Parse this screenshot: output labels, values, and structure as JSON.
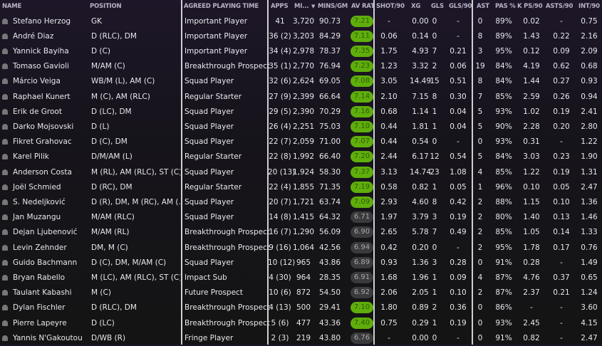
{
  "headers": {
    "name": "NAME",
    "position": "POSITION",
    "playing_time": "AGREED PLAYING TIME",
    "apps": "APPS",
    "mins": "MI...",
    "sort_icon": "▼",
    "mins_gm": "MINS/GM",
    "av_rat": "AV RAT",
    "shot90": "SHOT/90",
    "xg": "XG",
    "gls": "GLS",
    "gls90": "GLS/90",
    "ast": "AST",
    "pas": "PAS %",
    "kps90": "K PS/90",
    "asts90": "ASTS/90",
    "int90": "INT/90"
  },
  "colors": {
    "rating_good": "#5fae0b",
    "rating_neutral": "#3a3a3c"
  },
  "players": [
    [
      "Stefano Herzog",
      "GK",
      "Important Player",
      "41",
      "3,720",
      "90.73",
      "7.21",
      "-",
      "0.00",
      "0",
      "-",
      "0",
      "89%",
      "0.02",
      "-",
      "0.75"
    ],
    [
      "André Diaz",
      "D (RLC), DM",
      "Important Player",
      "36 (2)",
      "3,203",
      "84.29",
      "7.11",
      "0.06",
      "0.14",
      "0",
      "-",
      "8",
      "89%",
      "1.43",
      "0.22",
      "2.16"
    ],
    [
      "Yannick Bayiha",
      "D (C)",
      "Important Player",
      "34 (4)",
      "2,978",
      "78.37",
      "7.35",
      "1.75",
      "4.93",
      "7",
      "0.21",
      "3",
      "95%",
      "0.12",
      "0.09",
      "2.09"
    ],
    [
      "Tomaso Gavioli",
      "M/AM (C)",
      "Breakthrough Prospect",
      "35 (1)",
      "2,770",
      "76.94",
      "7.23",
      "1.23",
      "3.32",
      "2",
      "0.06",
      "19",
      "84%",
      "4.19",
      "0.62",
      "0.68"
    ],
    [
      "Márcio Veiga",
      "WB/M (L), AM (C)",
      "Squad Player",
      "32 (6)",
      "2,624",
      "69.05",
      "7.08",
      "3.05",
      "14.49",
      "15",
      "0.51",
      "8",
      "84%",
      "1.44",
      "0.27",
      "0.93"
    ],
    [
      "Raphael Kunert",
      "M (C), AM (RLC)",
      "Regular Starter",
      "27 (9)",
      "2,399",
      "66.64",
      "7.14",
      "2.10",
      "7.15",
      "8",
      "0.30",
      "7",
      "85%",
      "2.59",
      "0.26",
      "0.94"
    ],
    [
      "Erik de Groot",
      "D (LC), DM",
      "Squad Player",
      "29 (5)",
      "2,390",
      "70.29",
      "7.16",
      "0.68",
      "1.14",
      "1",
      "0.04",
      "5",
      "93%",
      "1.02",
      "0.19",
      "2.41"
    ],
    [
      "Darko Mojsovski",
      "D (L)",
      "Squad Player",
      "26 (4)",
      "2,251",
      "75.03",
      "7.10",
      "0.44",
      "1.81",
      "1",
      "0.04",
      "5",
      "90%",
      "2.28",
      "0.20",
      "2.80"
    ],
    [
      "Fikret Grahovac",
      "D (C), DM",
      "Squad Player",
      "22 (7)",
      "2,059",
      "71.00",
      "7.07",
      "0.44",
      "0.54",
      "0",
      "-",
      "0",
      "93%",
      "0.31",
      "-",
      "1.22"
    ],
    [
      "Karel Pilik",
      "D/M/AM (L)",
      "Regular Starter",
      "22 (8)",
      "1,992",
      "66.40",
      "7.20",
      "2.44",
      "6.17",
      "12",
      "0.54",
      "5",
      "84%",
      "3.03",
      "0.23",
      "1.90"
    ],
    [
      "Anderson Costa",
      "M (RL), AM (RLC), ST (C)",
      "Squad Player",
      "20 (13)",
      "1,924",
      "58.30",
      "7.37",
      "3.13",
      "14.74",
      "23",
      "1.08",
      "4",
      "85%",
      "1.22",
      "0.19",
      "1.31"
    ],
    [
      "Joël Schmied",
      "D (RC), DM",
      "Regular Starter",
      "22 (4)",
      "1,855",
      "71.35",
      "7.19",
      "0.58",
      "0.82",
      "1",
      "0.05",
      "1",
      "96%",
      "0.10",
      "0.05",
      "2.47"
    ],
    [
      "S. Nedeljković",
      "D (R), DM, M (RC), AM (...",
      "Squad Player",
      "20 (7)",
      "1,721",
      "63.74",
      "7.09",
      "2.93",
      "4.60",
      "8",
      "0.42",
      "2",
      "88%",
      "1.15",
      "0.10",
      "1.36"
    ],
    [
      "Jan Muzangu",
      "M/AM (RLC)",
      "Squad Player",
      "14 (8)",
      "1,415",
      "64.32",
      "6.71",
      "1.97",
      "3.79",
      "3",
      "0.19",
      "2",
      "80%",
      "1.40",
      "0.13",
      "1.46"
    ],
    [
      "Dejan Ljubenović",
      "M/AM (RL)",
      "Breakthrough Prospect",
      "16 (7)",
      "1,290",
      "56.09",
      "6.90",
      "2.65",
      "5.78",
      "7",
      "0.49",
      "2",
      "85%",
      "1.05",
      "0.14",
      "1.33"
    ],
    [
      "Levin Zehnder",
      "DM, M (C)",
      "Breakthrough Prospect",
      "9 (16)",
      "1,064",
      "42.56",
      "6.94",
      "0.42",
      "0.20",
      "0",
      "-",
      "2",
      "95%",
      "1.78",
      "0.17",
      "0.76"
    ],
    [
      "Guido Bachmann",
      "D (C), DM, M/AM (C)",
      "Squad Player",
      "10 (12)",
      "965",
      "43.86",
      "6.89",
      "0.93",
      "1.36",
      "3",
      "0.28",
      "0",
      "91%",
      "0.28",
      "-",
      "1.49"
    ],
    [
      "Bryan Rabello",
      "M (LC), AM (RLC), ST (C)",
      "Impact Sub",
      "4 (30)",
      "964",
      "28.35",
      "6.91",
      "1.68",
      "1.96",
      "1",
      "0.09",
      "4",
      "87%",
      "4.76",
      "0.37",
      "0.65"
    ],
    [
      "Taulant Kabashi",
      "M (C)",
      "Future Prospect",
      "10 (6)",
      "872",
      "54.50",
      "6.92",
      "2.06",
      "2.05",
      "1",
      "0.10",
      "2",
      "87%",
      "2.37",
      "0.21",
      "1.24"
    ],
    [
      "Dylan Fischler",
      "D (RLC), DM",
      "Breakthrough Prospect",
      "4 (13)",
      "500",
      "29.41",
      "7.10",
      "1.80",
      "0.89",
      "2",
      "0.36",
      "0",
      "86%",
      "-",
      "-",
      "3.60"
    ],
    [
      "Pierre Lapeyre",
      "D (LC)",
      "Breakthrough Prospect",
      "5 (6)",
      "477",
      "43.36",
      "7.40",
      "0.75",
      "0.29",
      "1",
      "0.19",
      "0",
      "93%",
      "2.45",
      "-",
      "4.15"
    ],
    [
      "Yannis N'Gakoutou",
      "D/WB (R)",
      "Fringe Player",
      "2 (3)",
      "219",
      "43.80",
      "6.76",
      "-",
      "0.00",
      "0",
      "-",
      "0",
      "91%",
      "0.82",
      "-",
      "2.47"
    ]
  ]
}
